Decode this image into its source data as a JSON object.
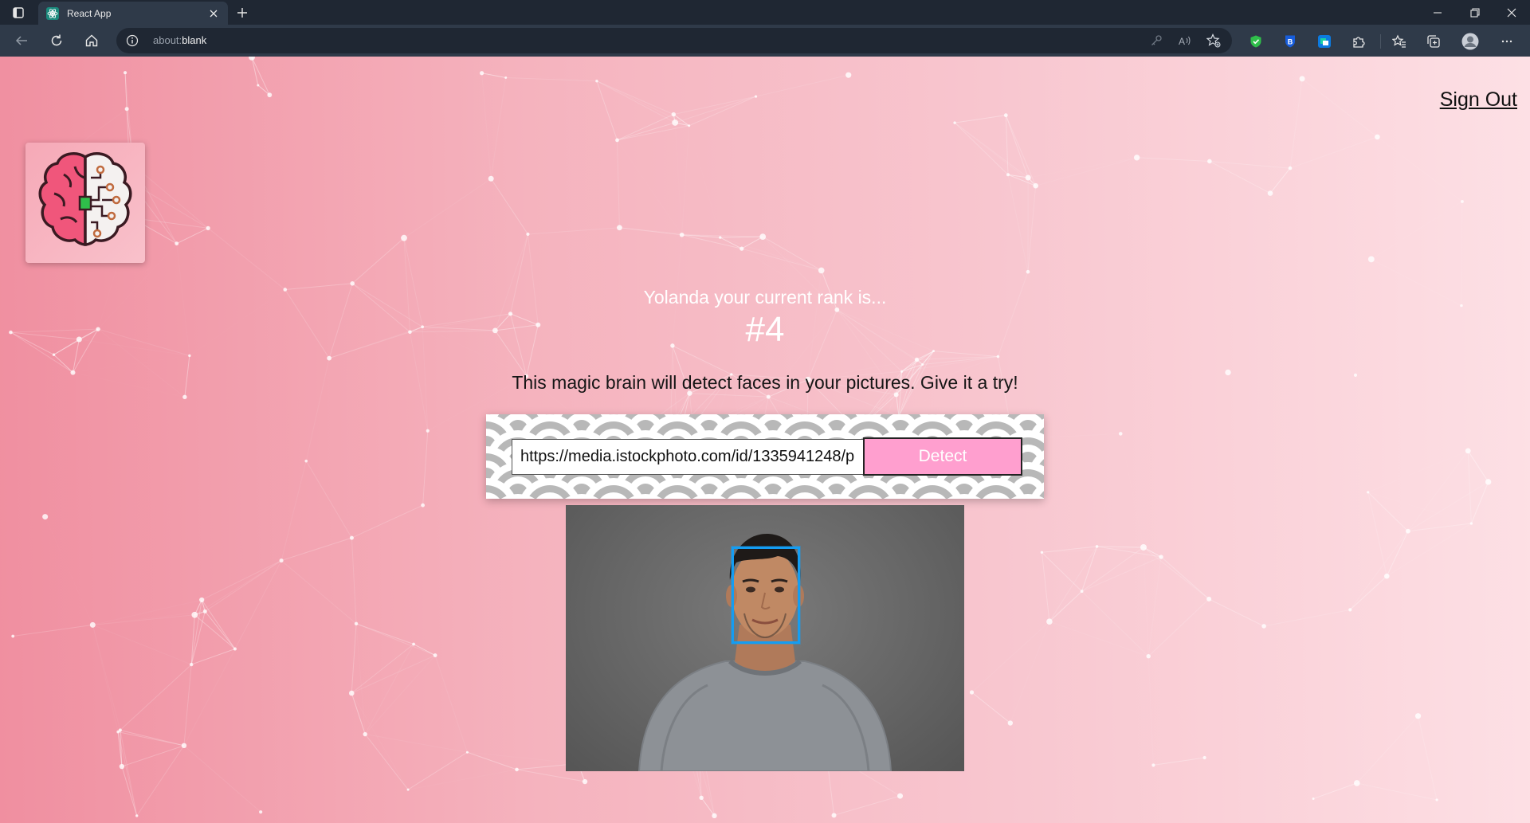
{
  "browser": {
    "tab": {
      "title": "React App",
      "favicon": "react-logo-icon"
    },
    "address": {
      "prefix": "about:",
      "value": "blank"
    }
  },
  "app": {
    "signout_label": "Sign Out",
    "logo": "brain-logo-icon",
    "rank_text": "Yolanda your current rank is...",
    "rank_value": "#4",
    "tagline": "This magic brain will detect faces in your pictures. Give it a try!",
    "image_url": "https://media.istockphoto.com/id/1335941248/p",
    "detect_label": "Detect"
  },
  "colors": {
    "tabbar": "#1f2733",
    "toolbar": "#2f3a49",
    "bg_left": "#f08fa0",
    "bg_right": "#fde0e5",
    "detect_button": "#ff9fcf",
    "face_box": "#149df2"
  }
}
